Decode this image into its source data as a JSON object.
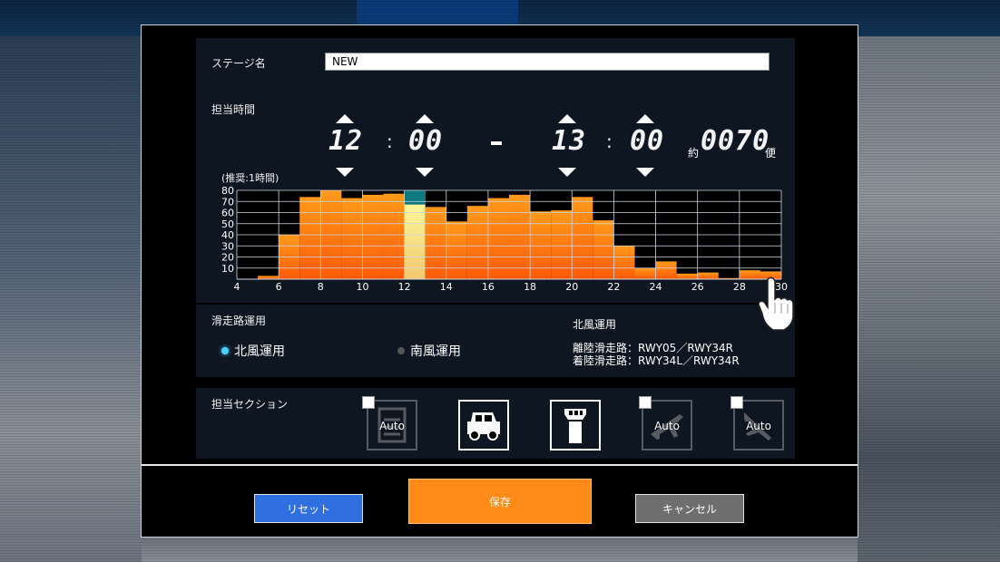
{
  "stage": {
    "label": "ステージ名",
    "value": "NEW"
  },
  "time": {
    "label": "担当時間",
    "start_hour": "12",
    "start_min": "00",
    "end_hour": "13",
    "end_min": "00",
    "flights_prefix": "約",
    "flights": "0070",
    "flights_suffix": "便",
    "recommend": "(推奨:1時間)"
  },
  "chart_data": {
    "type": "bar",
    "x": [
      5,
      6,
      7,
      8,
      9,
      10,
      11,
      12,
      13,
      14,
      15,
      16,
      17,
      18,
      19,
      20,
      21,
      22,
      23,
      24,
      25,
      26,
      27,
      28,
      29
    ],
    "values": [
      3,
      40,
      74,
      80,
      73,
      76,
      77,
      80,
      65,
      52,
      66,
      73,
      76,
      61,
      62,
      74,
      53,
      30,
      10,
      16,
      5,
      6,
      1,
      8,
      7
    ],
    "selected": [
      12,
      13
    ],
    "xticks": [
      "4",
      "6",
      "8",
      "10",
      "12",
      "14",
      "16",
      "18",
      "20",
      "22",
      "24",
      "26",
      "28",
      "30"
    ],
    "yticks": [
      "10",
      "20",
      "30",
      "40",
      "50",
      "60",
      "70",
      "80"
    ],
    "xlim": [
      4,
      30
    ],
    "ylim": [
      0,
      80
    ],
    "grid": true,
    "colors": {
      "bar_top": "#ff9a1a",
      "bar_bottom": "#ff5a08",
      "selected_top": "#ffffa0",
      "selected_bottom": "#f2c870",
      "selected_cap": "#0a7a80"
    }
  },
  "runway": {
    "label": "滑走路運用",
    "option_north": "北風運用",
    "option_south": "南風運用",
    "selected": "north",
    "info_title": "北風運用",
    "takeoff": "離陸滑走路：RWY05／RWY34R",
    "landing": "着陸滑走路：RWY34L／RWY34R"
  },
  "section": {
    "label": "担当セクション",
    "items": [
      {
        "name": "delivery",
        "auto": "Auto",
        "active": false
      },
      {
        "name": "ground",
        "auto": "",
        "active": true
      },
      {
        "name": "tower",
        "auto": "",
        "active": true
      },
      {
        "name": "departure",
        "auto": "Auto",
        "active": false
      },
      {
        "name": "approach",
        "auto": "Auto",
        "active": false
      }
    ]
  },
  "buttons": {
    "reset": "リセット",
    "save": "保存",
    "cancel": "キャンセル"
  }
}
